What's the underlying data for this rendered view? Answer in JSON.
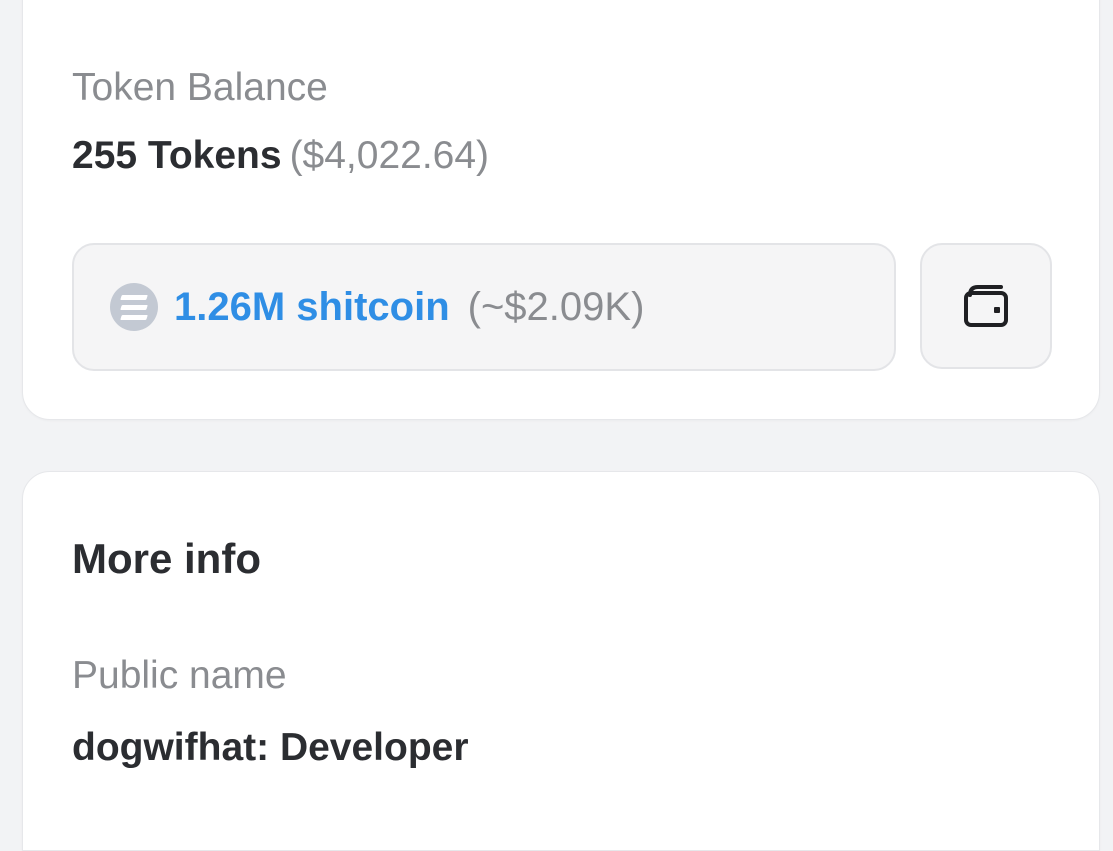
{
  "token_balance": {
    "label": "Token Balance",
    "amount": "255 Tokens",
    "usd_value": "($4,022.64)"
  },
  "holding": {
    "icon": "solana-coin-icon",
    "amount": "1.26M shitcoin",
    "usd_estimate": "(~$2.09K)",
    "accent_color": "#2f8ee5"
  },
  "wallet_button": {
    "icon": "wallet-icon"
  },
  "more_info": {
    "title": "More info",
    "public_name_label": "Public name",
    "public_name_value": "dogwifhat: Developer"
  }
}
